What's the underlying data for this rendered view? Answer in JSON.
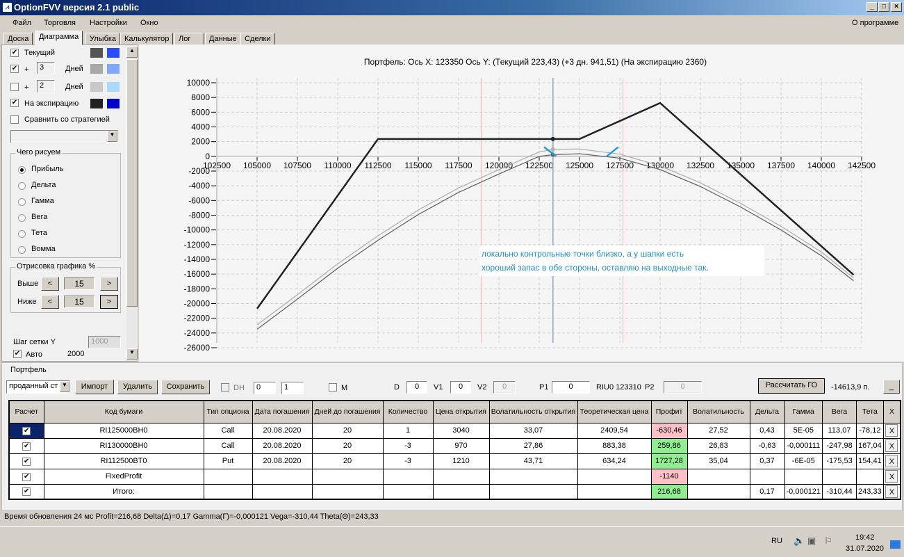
{
  "window": {
    "title": "OptionFVV версия 2.1 public",
    "icon": "chart-icon"
  },
  "menu": [
    "Файл",
    "Торговля",
    "Настройки",
    "Окно"
  ],
  "menu_about": "О программе",
  "tabs": [
    "Доска",
    "Диаграмма",
    "Улыбка",
    "Калькулятор",
    "Лог",
    "Данные",
    "Сделки"
  ],
  "left": {
    "current_label": "Текущий",
    "current_checked": true,
    "plus": "+",
    "days_label": "Дней",
    "days1": "3",
    "days1_checked": true,
    "days2": "2",
    "days2_checked": false,
    "expiry_label": "На экспирацию",
    "expiry_checked": true,
    "compare_label": "Сравнить со стратегией",
    "compare_checked": false,
    "draw_group": "Чего рисуем",
    "draw_options": [
      "Прибыль",
      "Дельта",
      "Гамма",
      "Вега",
      "Тета",
      "Вомма"
    ],
    "draw_selected": "Прибыль",
    "render_group": "Отрисовка графика %",
    "above_label": "Выше",
    "above_value": "15",
    "below_label": "Ниже",
    "below_value": "15",
    "btn_left": "<",
    "btn_right": ">",
    "grid_step_label": "Шаг сетки Y",
    "grid_step_value": "1000",
    "auto_label": "Авто",
    "auto_value": "2000",
    "auto_checked": true,
    "colors": {
      "current": [
        "#555555",
        "#2a4cff"
      ],
      "days1": [
        "#a8a8a8",
        "#7fa8ff"
      ],
      "days2": [
        "#c8c8c8",
        "#aad8ff"
      ],
      "expiry": [
        "#222222",
        "#0000c8"
      ]
    }
  },
  "chart_data": {
    "type": "line",
    "title": "Портфель: Ось X: 123350 Ось Y:  (Текущий 223,43)  (+3 дн. 941,51)  (На экспирацию 2360)",
    "xlim": [
      102500,
      142500
    ],
    "ylim": [
      -26000,
      10000
    ],
    "xticks": [
      102500,
      105000,
      107500,
      110000,
      112500,
      115000,
      117500,
      120000,
      122500,
      125000,
      127500,
      130000,
      132500,
      135000,
      137500,
      140000,
      142500
    ],
    "yticks": [
      10000,
      8000,
      6000,
      4000,
      2000,
      0,
      -2000,
      -4000,
      -6000,
      -8000,
      -10000,
      -12000,
      -14000,
      -16000,
      -18000,
      -20000,
      -22000,
      -24000,
      -26000
    ],
    "grid": true,
    "cursor_x": 123350,
    "markers": [
      118900,
      127700
    ],
    "series": [
      {
        "name": "На экспирацию",
        "color": "#222222",
        "x": [
          105000,
          112500,
          125000,
          130000,
          142000
        ],
        "y": [
          -20700,
          2360,
          2360,
          7250,
          -16100
        ]
      },
      {
        "name": "+3 дн.",
        "color": "#b0b0b0",
        "x": [
          105000,
          107500,
          110000,
          112500,
          115000,
          117500,
          120000,
          122500,
          123350,
          125000,
          127500,
          130000,
          132500,
          135000,
          137500,
          140000,
          142000
        ],
        "y": [
          -22900,
          -18800,
          -14600,
          -10800,
          -7300,
          -4300,
          -1800,
          600,
          941.51,
          1000,
          300,
          -1300,
          -3600,
          -6400,
          -9500,
          -13000,
          -16500
        ]
      },
      {
        "name": "Текущий",
        "color": "#666666",
        "x": [
          105000,
          107500,
          110000,
          112500,
          115000,
          117500,
          120000,
          122500,
          123350,
          125000,
          127500,
          130000,
          132500,
          135000,
          137500,
          140000,
          142000
        ],
        "y": [
          -23500,
          -19400,
          -15200,
          -11400,
          -7900,
          -4900,
          -2400,
          0,
          223.43,
          350,
          -250,
          -1800,
          -4100,
          -6900,
          -10000,
          -13500,
          -16900
        ]
      }
    ],
    "annotation": [
      "локально контрольные точки близко, а у шапки есть",
      "хороший запас в обе стороны, оставляю на выходные так."
    ]
  },
  "portfolio": {
    "group": "Портфель",
    "select": "проданный ст",
    "import": "Импорт",
    "delete": "Удалить",
    "save": "Сохранить",
    "dh": "DH",
    "spin1": "0",
    "spin2": "1",
    "m": "M",
    "d_label": "D",
    "d": "0",
    "v1_label": "V1",
    "v1": "0",
    "v2_label": "V2",
    "v2": "0",
    "p1_label": "P1",
    "p1": "0",
    "riu": "RIU0 123310",
    "p2_label": "P2",
    "p2": "0",
    "calc": "Рассчитать ГО",
    "go": "-14613,9 п.",
    "min": "_",
    "headers": [
      "Расчет",
      "Код бумаги",
      "Тип опциона",
      "Дата погашения",
      "Дней до погашения",
      "Количество",
      "Цена открытия",
      "Волатильность открытия",
      "Теоретическая цена",
      "Профит",
      "Волатильность",
      "Дельта",
      "Гамма",
      "Вега",
      "Тета",
      "X"
    ],
    "rows": [
      [
        "RI125000BH0",
        "Call",
        "20.08.2020",
        "20",
        "1",
        "3040",
        "33,07",
        "2409,54",
        "-630,46",
        "27,52",
        "0,43",
        "5E-05",
        "113,07",
        "-78,12"
      ],
      [
        "RI130000BH0",
        "Call",
        "20.08.2020",
        "20",
        "-3",
        "970",
        "27,86",
        "883,38",
        "259,86",
        "26,83",
        "-0,63",
        "-0,000111",
        "-247,98",
        "167,04"
      ],
      [
        "RI112500BT0",
        "Put",
        "20.08.2020",
        "20",
        "-3",
        "1210",
        "43,71",
        "634,24",
        "1727,28",
        "35,04",
        "0,37",
        "-6E-05",
        "-175,53",
        "154,41"
      ],
      [
        "FixedProfit",
        "",
        "",
        "",
        "",
        "",
        "",
        "",
        "-1140",
        "",
        "",
        "",
        "",
        ""
      ],
      [
        "Итого:",
        "",
        "",
        "",
        "",
        "",
        "",
        "",
        "216,68",
        "",
        "0,17",
        "-0,000121",
        "-310,44",
        "243,33"
      ]
    ],
    "x": "X"
  },
  "status": "Время обновления 24 мс  Profit=216,68 Delta(Δ)=0,17 Gamma(Г)=-0,000121 Vega=-310,44 Theta(Θ)=243,33",
  "taskbar": {
    "lang": "RU",
    "time": "19:42",
    "date": "31.07.2020"
  }
}
